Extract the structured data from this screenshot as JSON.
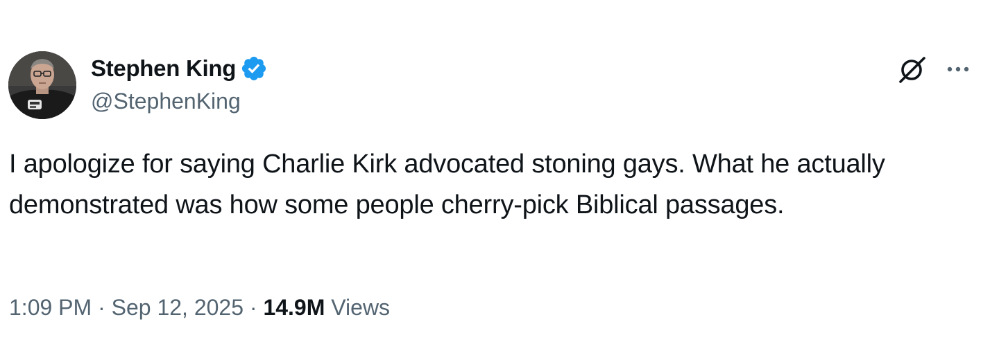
{
  "author": {
    "display_name": "Stephen King",
    "handle": "@StephenKing",
    "verified": true,
    "verified_color": "#1d9bf0"
  },
  "icons": {
    "verified": "verified-badge-icon",
    "grok": "grok-icon",
    "more": "more-horizontal-icon"
  },
  "tweet": {
    "text": "I apologize for saying Charlie Kirk advocated stoning gays. What he actually demonstrated was how some people cherry-pick Biblical passages."
  },
  "meta": {
    "time": "1:09 PM",
    "separator": "·",
    "date": "Sep 12, 2025",
    "views_count": "14.9M",
    "views_label": "Views"
  },
  "colors": {
    "text_primary": "#0f1419",
    "text_secondary": "#536471",
    "accent": "#1d9bf0"
  }
}
